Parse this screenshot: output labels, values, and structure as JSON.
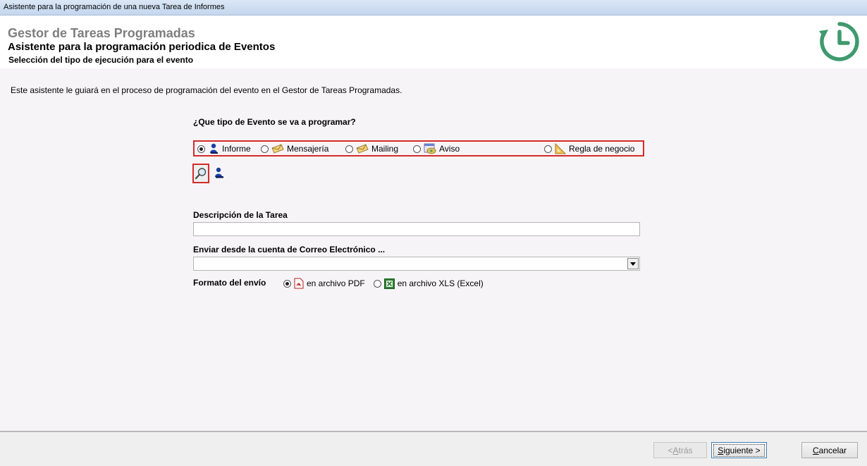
{
  "window": {
    "title": "Asistente para la programación de una nueva Tarea de Informes"
  },
  "header": {
    "app_title": "Gestor de Tareas Programadas",
    "wizard_title": "Asistente para la programación periodica de Eventos",
    "step_title": "Selección del tipo de ejecución para el evento",
    "icon": "clock-history-icon",
    "accent_color": "#3f9a6e"
  },
  "intro": "Este asistente le guiará en el proceso de programación del evento en el Gestor de Tareas Programadas.",
  "event_type": {
    "question": "¿Que tipo de Evento se va a programar?",
    "options": [
      {
        "label": "Informe",
        "icon": "report-user-icon",
        "selected": true
      },
      {
        "label": "Mensajería",
        "icon": "envelope-icon",
        "selected": false
      },
      {
        "label": "Mailing",
        "icon": "envelope-icon",
        "selected": false
      },
      {
        "label": "Aviso",
        "icon": "notice-icon",
        "selected": false
      },
      {
        "label": "Regla de negocio",
        "icon": "ruler-triangle-icon",
        "selected": false
      }
    ],
    "highlight_color": "#d32b2b"
  },
  "description": {
    "label": "Descripción de la Tarea",
    "value": ""
  },
  "email_account": {
    "label": "Enviar desde la cuenta de Correo Electrónico ...",
    "value": ""
  },
  "format": {
    "label": "Formato del envío",
    "options": [
      {
        "label": "en archivo PDF",
        "icon": "pdf-icon",
        "selected": true
      },
      {
        "label": "en archivo XLS (Excel)",
        "icon": "excel-icon",
        "selected": false
      }
    ]
  },
  "buttons": {
    "back": {
      "prefix": "< ",
      "mnemonic": "A",
      "rest": "trás",
      "enabled": false
    },
    "next": {
      "mnemonic": "S",
      "rest": "iguiente >"
    },
    "cancel": {
      "mnemonic": "C",
      "rest": "ancelar"
    }
  }
}
